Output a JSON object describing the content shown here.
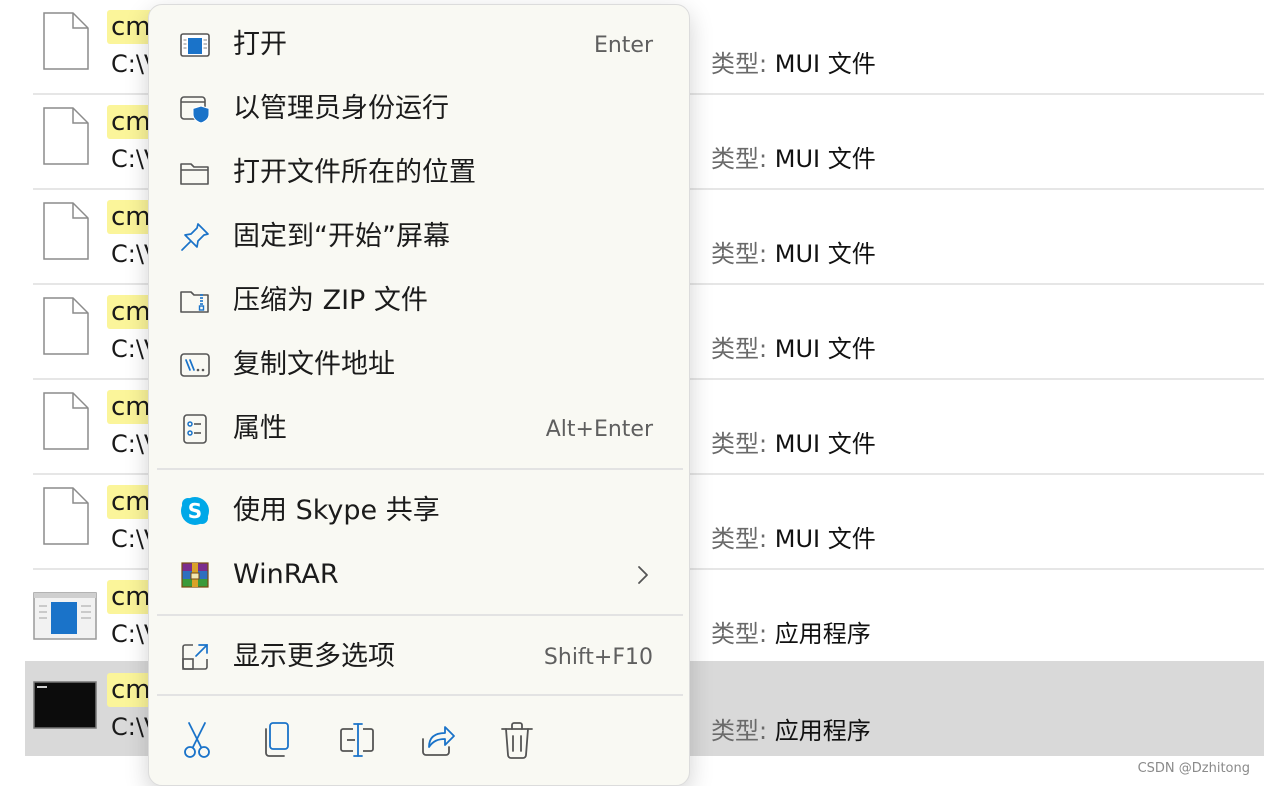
{
  "file_list": {
    "rows": [
      {
        "highlight": "cm",
        "path": "C:\\V",
        "type_key": "类型:",
        "type_value": "MUI 文件",
        "icon": "document-icon"
      },
      {
        "highlight": "cm",
        "path": "C:\\V",
        "type_key": "类型:",
        "type_value": "MUI 文件",
        "icon": "document-icon"
      },
      {
        "highlight": "cm",
        "path": "C:\\V",
        "type_key": "类型:",
        "type_value": "MUI 文件",
        "icon": "document-icon"
      },
      {
        "highlight": "cm",
        "path": "C:\\V",
        "type_key": "类型:",
        "type_value": "MUI 文件",
        "icon": "document-icon"
      },
      {
        "highlight": "cm",
        "path": "C:\\V",
        "type_key": "类型:",
        "type_value": "MUI 文件",
        "icon": "document-icon"
      },
      {
        "highlight": "cm",
        "path": "C:\\V",
        "type_key": "类型:",
        "type_value": "MUI 文件",
        "icon": "document-icon"
      },
      {
        "highlight": "cm",
        "path": "C:\\V",
        "type_key": "类型:",
        "type_value": "应用程序",
        "icon": "application-icon"
      },
      {
        "highlight": "cm",
        "path": "C:\\V",
        "type_key": "类型:",
        "type_value": "应用程序",
        "icon": "terminal-icon",
        "selected": true
      }
    ]
  },
  "context_menu": {
    "items": [
      {
        "label": "打开",
        "shortcut": "Enter",
        "icon": "open-window-icon"
      },
      {
        "label": "以管理员身份运行",
        "shortcut": "",
        "icon": "admin-shield-icon"
      },
      {
        "label": "打开文件所在的位置",
        "shortcut": "",
        "icon": "folder-icon"
      },
      {
        "label": "固定到“开始”屏幕",
        "shortcut": "",
        "icon": "pin-icon"
      },
      {
        "label": "压缩为 ZIP 文件",
        "shortcut": "",
        "icon": "zip-folder-icon"
      },
      {
        "label": "复制文件地址",
        "shortcut": "",
        "icon": "copy-path-icon"
      },
      {
        "label": "属性",
        "shortcut": "Alt+Enter",
        "icon": "properties-icon"
      },
      {
        "label": "使用 Skype 共享",
        "shortcut": "",
        "icon": "skype-icon"
      },
      {
        "label": "WinRAR",
        "shortcut": "",
        "icon": "winrar-icon",
        "submenu": true
      },
      {
        "label": "显示更多选项",
        "shortcut": "Shift+F10",
        "icon": "show-more-icon"
      }
    ],
    "toolbar": [
      {
        "name": "cut",
        "icon": "scissors-icon"
      },
      {
        "name": "copy",
        "icon": "copy-icon"
      },
      {
        "name": "rename",
        "icon": "rename-icon"
      },
      {
        "name": "share",
        "icon": "share-icon"
      },
      {
        "name": "delete",
        "icon": "trash-icon"
      }
    ],
    "accent_color": "#0067c0"
  },
  "watermark": "CSDN @Dzhitong"
}
